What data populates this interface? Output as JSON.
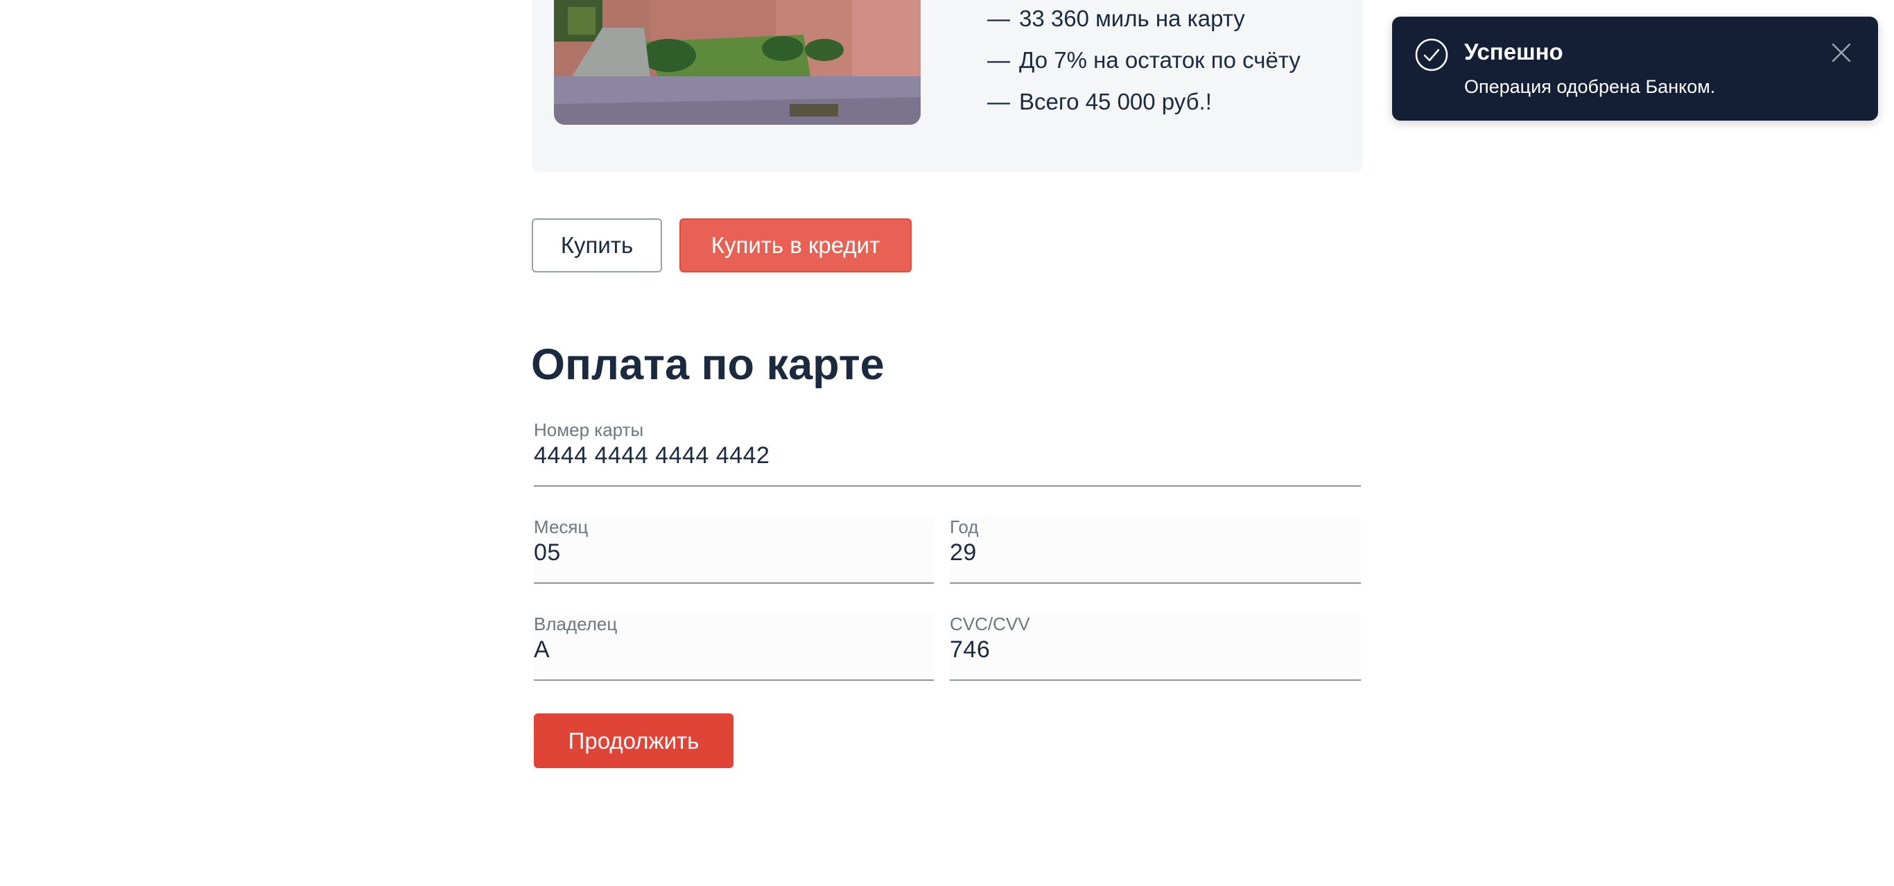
{
  "product": {
    "photo_alt": "",
    "features": [
      "33 360 миль на карту",
      "До 7% на остаток по счёту",
      "Всего 45 000 руб.!"
    ],
    "dash": "—"
  },
  "actions": {
    "buy_label": "Купить",
    "credit_label": "Купить в кредит"
  },
  "payment": {
    "title": "Оплата по карте",
    "card_number": {
      "label": "Номер карты",
      "value": "4444 4444 4444 4442"
    },
    "month": {
      "label": "Месяц",
      "value": "05"
    },
    "year": {
      "label": "Год",
      "value": "29"
    },
    "owner": {
      "label": "Владелец",
      "value": "А"
    },
    "cvc": {
      "label": "CVC/CVV",
      "value": "746"
    },
    "continue_label": "Продолжить"
  },
  "toast": {
    "title": "Успешно",
    "message": "Операция одобрена Банком.",
    "icon": "check-circle-icon",
    "close_icon": "close-icon"
  },
  "colors": {
    "accent": "#e04436",
    "credit_button": "#e86154",
    "toast_bg": "#141f36",
    "text": "#1b2a3f"
  }
}
